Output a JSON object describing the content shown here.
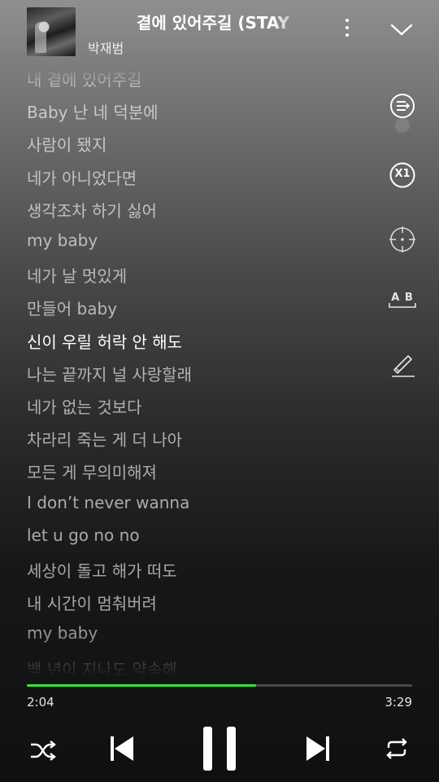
{
  "header": {
    "title": "곁에 있어주길 (STAY",
    "artist": "박재범"
  },
  "lyrics": [
    {
      "text": "내 곁에 있어주길",
      "active": false
    },
    {
      "text": "Baby 난 네 덕분에",
      "active": false
    },
    {
      "text": "사람이 됐지",
      "active": false
    },
    {
      "text": "네가 아니었다면",
      "active": false
    },
    {
      "text": "생각조차 하기 싫어",
      "active": false
    },
    {
      "text": "my baby",
      "active": false
    },
    {
      "text": "네가 날 멋있게",
      "active": false
    },
    {
      "text": "만들어 baby",
      "active": false
    },
    {
      "text": "신이 우릴 허락 안 해도",
      "active": true
    },
    {
      "text": "나는 끝까지 널 사랑할래",
      "active": false
    },
    {
      "text": "네가 없는 것보다",
      "active": false
    },
    {
      "text": "차라리 죽는 게 더 나아",
      "active": false
    },
    {
      "text": "모든 게 무의미해져",
      "active": false
    },
    {
      "text": "I don’t never wanna",
      "active": false
    },
    {
      "text": "let u go no no",
      "active": false
    },
    {
      "text": "세상이 돌고 해가 떠도",
      "active": false
    },
    {
      "text": "내 시간이 멈춰버려",
      "active": false
    },
    {
      "text": "my baby",
      "active": false
    },
    {
      "text": "백 년이 지나도 약속해",
      "active": false
    }
  ],
  "side_tools": {
    "speed_label": "X1",
    "translate_label": "A B"
  },
  "player": {
    "elapsed": "2:04",
    "duration": "3:29",
    "progress": 0.595,
    "accent_color": "#2ee83a"
  },
  "icons": [
    "album-art",
    "more-icon",
    "chevron-down-icon",
    "playlist-toggle-icon",
    "speed-icon",
    "focus-icon",
    "translate-icon",
    "pen-icon",
    "shuffle-icon",
    "previous-icon",
    "pause-icon",
    "next-icon",
    "repeat-icon"
  ]
}
